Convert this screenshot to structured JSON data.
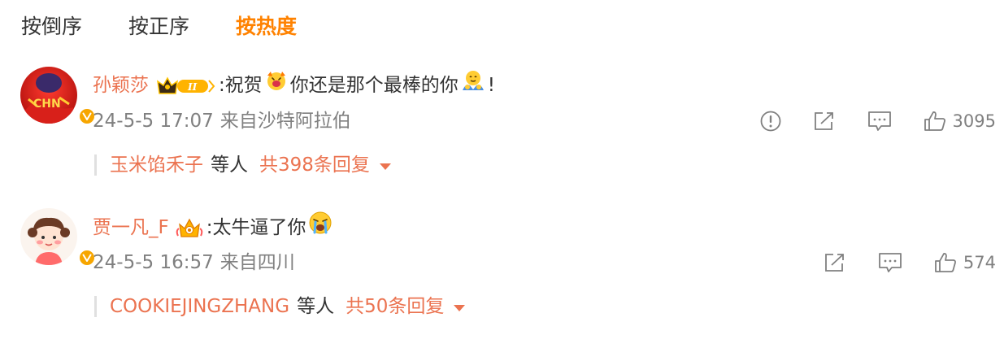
{
  "sort_tabs": [
    {
      "label": "按倒序",
      "active": false
    },
    {
      "label": "按正序",
      "active": false
    },
    {
      "label": "按热度",
      "active": true
    }
  ],
  "comments": [
    {
      "user": "孙颖莎",
      "badge_icon": "crown-level-II-badge",
      "badge_text": "II",
      "text_part1": ":祝贺",
      "emoji1": "cheering-face-emoji",
      "text_part2": " 你还是那个最棒的你",
      "emoji2": "hug-emoji",
      "text_part3": "!",
      "time": "24-5-5 17:07",
      "location": "来自沙特阿拉伯",
      "likes": "3095",
      "reply_user": "玉米馅禾子",
      "reply_etc": "等人",
      "reply_count": "共398条回复"
    },
    {
      "user": "贾一凡_F",
      "badge_icon": "crown-fan-badge",
      "text_part1": ":太牛逼了你",
      "emoji1": "crying-face-emoji",
      "time": "24-5-5 16:57",
      "location": "来自四川",
      "likes": "574",
      "reply_user": "COOKIEJINGZHANG",
      "reply_etc": "等人",
      "reply_count": "共50条回复"
    }
  ],
  "colors": {
    "accent_orange": "#ff8200",
    "username": "#eb7350",
    "meta_gray": "#808080",
    "verified": "#f7a600"
  }
}
